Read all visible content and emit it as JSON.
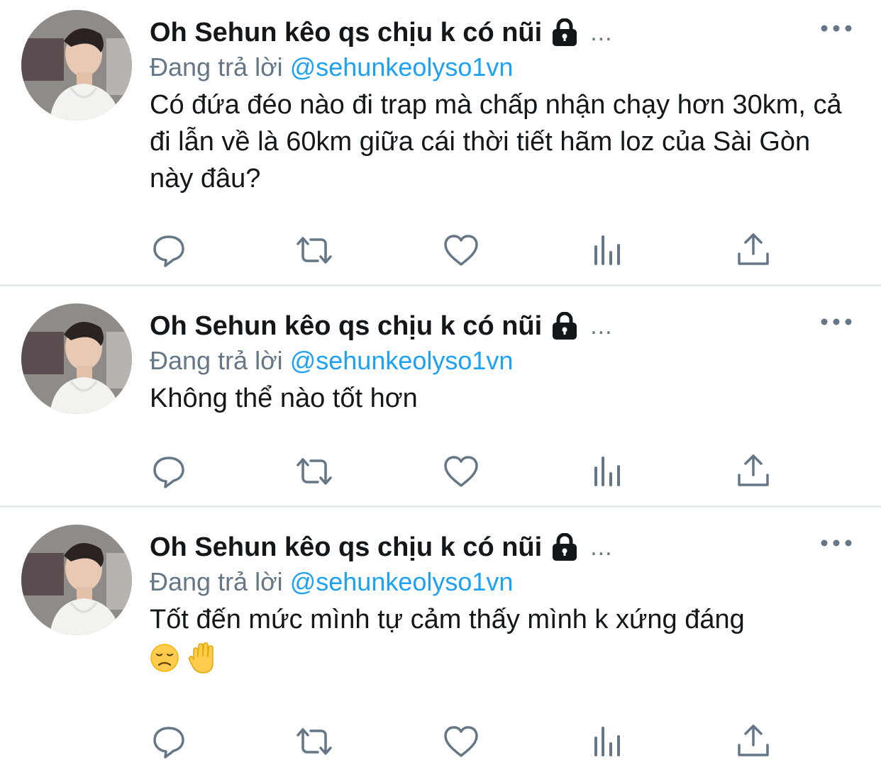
{
  "tweets": [
    {
      "display_name": "Oh Sehun kêo qs chịu k có nũi",
      "truncation": "...",
      "reply_prefix": "Đang trả lời",
      "reply_handle": "@sehunkeolyso1vn",
      "text": "Có đứa đéo nào đi trap mà chấp nhận chạy hơn 30km, cả đi lẫn về là 60km giữa cái thời tiết hãm loz của Sài Gòn này đâu?"
    },
    {
      "display_name": "Oh Sehun kêo qs chịu k có nũi",
      "truncation": "...",
      "reply_prefix": "Đang trả lời",
      "reply_handle": "@sehunkeolyso1vn",
      "text": "Không thể nào tốt hơn"
    },
    {
      "display_name": "Oh Sehun kêo qs chịu k có nũi",
      "truncation": "...",
      "reply_prefix": "Đang trả lời",
      "reply_handle": "@sehunkeolyso1vn",
      "text": "Tốt đến mức mình tự cảm thấy mình k xứng đáng",
      "emojis": [
        "disappointed-face",
        "raised-hand"
      ]
    }
  ],
  "icons": {
    "avatar": "profile-photo",
    "lock": "lock-icon",
    "more": "more-dots-icon",
    "actions": [
      "reply-icon",
      "retweet-icon",
      "like-icon",
      "analytics-icon",
      "share-icon"
    ]
  },
  "colors": {
    "text": "#14171a",
    "secondary": "#657786",
    "link": "#1da1f2",
    "divider": "#e6ecf0"
  }
}
